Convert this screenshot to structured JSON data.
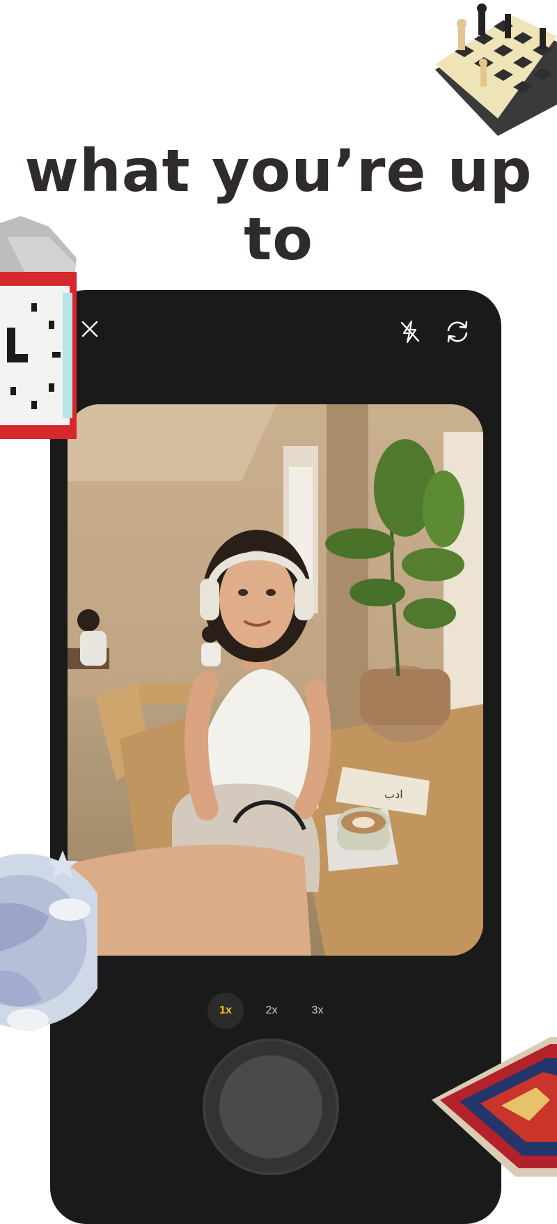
{
  "headline": "what you’re up to",
  "camera": {
    "close_icon": "close-icon",
    "flash_icon": "flash-off-icon",
    "flip_icon": "flip-camera-icon",
    "zoom_options": [
      "1x",
      "2x",
      "3x"
    ],
    "zoom_selected": "1x",
    "accent_color": "#f5c518"
  },
  "photo": {
    "book_title": "ادب"
  },
  "stickers": [
    "chess-board-sticker",
    "alarm-clock-sticker",
    "globe-sticker",
    "rug-sticker"
  ]
}
